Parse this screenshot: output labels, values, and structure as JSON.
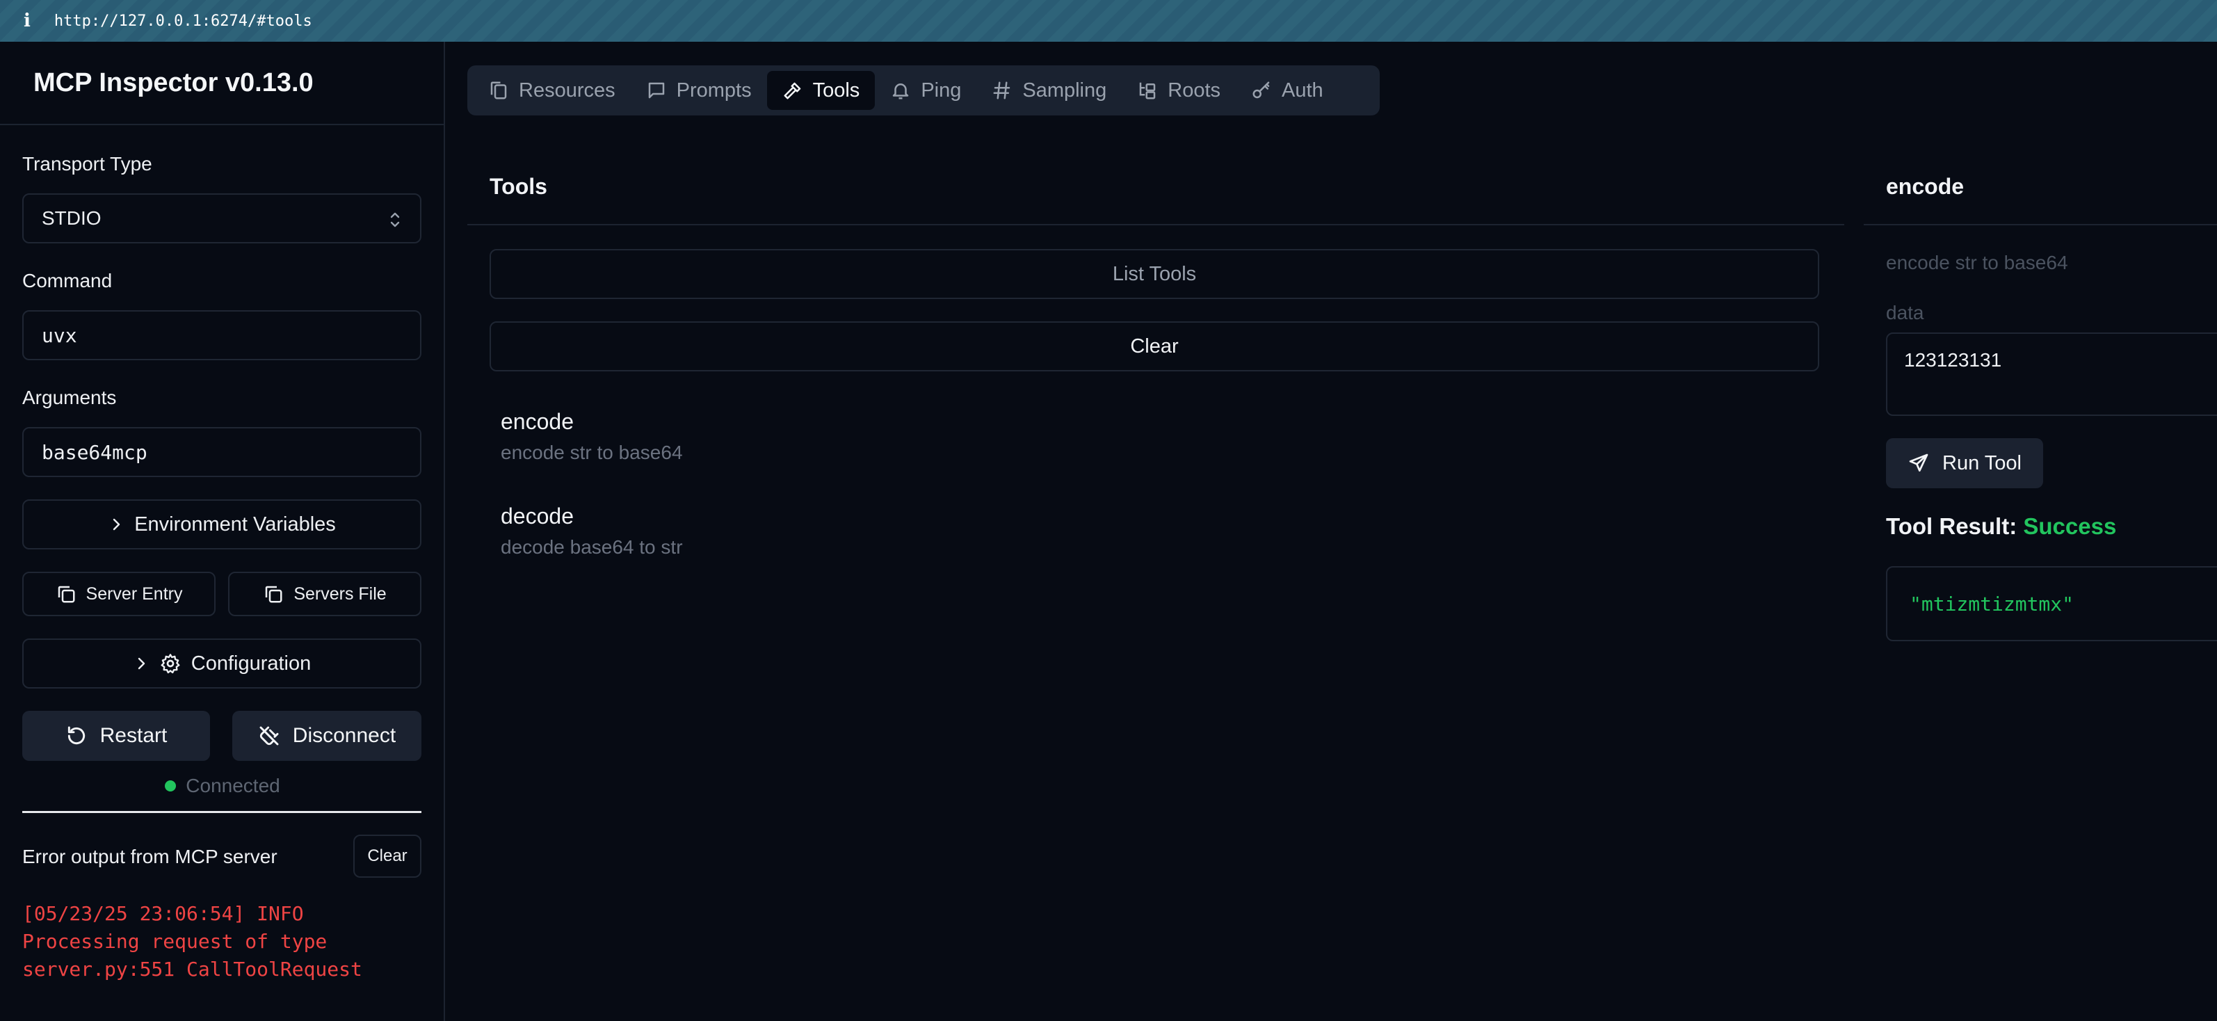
{
  "browser": {
    "info_icon": "i",
    "url": "http://127.0.0.1:6274/#tools"
  },
  "sidebar": {
    "title": "MCP Inspector v0.13.0",
    "transport_label": "Transport Type",
    "transport_value": "STDIO",
    "command_label": "Command",
    "command_value": "uvx",
    "arguments_label": "Arguments",
    "arguments_value": "base64mcp",
    "env_vars_label": "Environment Variables",
    "server_entry_label": "Server Entry",
    "servers_file_label": "Servers File",
    "configuration_label": "Configuration",
    "restart_label": "Restart",
    "disconnect_label": "Disconnect",
    "status_text": "Connected",
    "error_title": "Error output from MCP server",
    "error_clear_label": "Clear",
    "error_log": "[05/23/25 23:06:54] INFO\nProcessing request of type\nserver.py:551 CallToolRequest"
  },
  "tabs": [
    {
      "label": "Resources",
      "icon": "files-icon"
    },
    {
      "label": "Prompts",
      "icon": "message-square-icon"
    },
    {
      "label": "Tools",
      "icon": "hammer-icon",
      "active": true
    },
    {
      "label": "Ping",
      "icon": "bell-icon"
    },
    {
      "label": "Sampling",
      "icon": "hash-icon"
    },
    {
      "label": "Roots",
      "icon": "folder-tree-icon"
    },
    {
      "label": "Auth",
      "icon": "key-icon"
    }
  ],
  "tools_panel": {
    "title": "Tools",
    "list_tools_label": "List Tools",
    "clear_label": "Clear",
    "items": [
      {
        "name": "encode",
        "description": "encode str to base64"
      },
      {
        "name": "decode",
        "description": "decode base64 to str"
      }
    ]
  },
  "detail_panel": {
    "title": "encode",
    "description": "encode str to base64",
    "param_label": "data",
    "param_value": "123123131",
    "run_label": "Run Tool",
    "result_label": "Tool Result:",
    "result_status": "Success",
    "result_value": "\"mtizmtizmtmx\""
  },
  "colors": {
    "success": "#22c55e",
    "error": "#ef4444",
    "background": "#070b14",
    "surface": "#1b2230"
  }
}
